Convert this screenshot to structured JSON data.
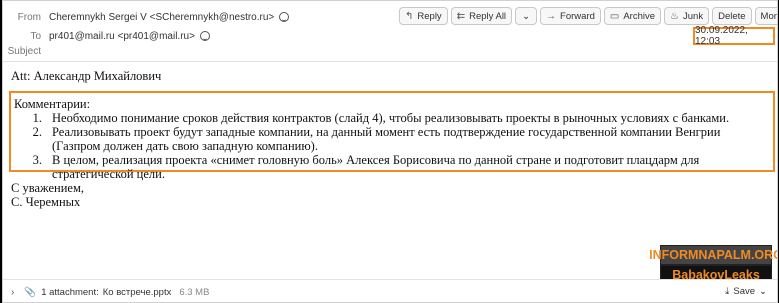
{
  "header": {
    "from_label": "From",
    "from_value": "Cheremnykh Sergei V <SCheremnykh@nestro.ru>",
    "to_label": "To",
    "to_value": "pr401@mail.ru <pr401@mail.ru>",
    "subject_label": "Subject",
    "subject_value": "",
    "date": "30.09.2022, 12:03"
  },
  "toolbar": {
    "reply": "Reply",
    "reply_all": "Reply All",
    "forward": "Forward",
    "archive": "Archive",
    "junk": "Junk",
    "delete": "Delete",
    "more": "More"
  },
  "body": {
    "att_line": "Att: Александр Михайлович",
    "comments_title": "Комментарии:",
    "items": [
      {
        "num": "1.",
        "text": "Необходимо понимание сроков действия контрактов (слайд 4), чтобы реализовывать проекты в рыночных условиях с банками."
      },
      {
        "num": "2.",
        "text": "Реализовывать проект будут западные компании, на данный момент есть подтверждение государственной компании Венгрии (Газпром должен дать свою западную компанию)."
      },
      {
        "num": "3.",
        "text": "В целом, реализация проекта «снимет головную боль» Алексея Борисовича по данной стране и подготовит плацдарм для стратегической цели."
      }
    ],
    "regards": "С уважением,",
    "signature": "С. Черемных"
  },
  "footer": {
    "attachment_count": "1 attachment:",
    "attachment_name": "Ко встрече.pptx",
    "attachment_size": "6.3 MB",
    "save": "Save"
  },
  "watermark": {
    "line1": "INFORMNAPALM.ORG",
    "line2": "BabakovLeaks"
  }
}
